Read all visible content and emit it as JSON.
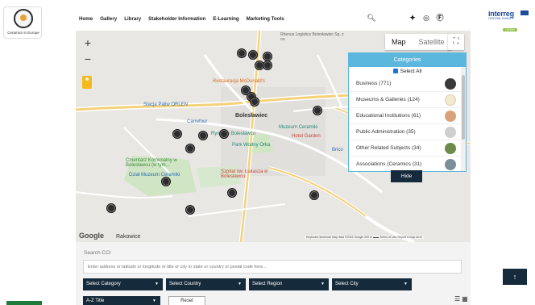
{
  "header": {
    "logo_text": "Ceramics in Europe",
    "nav": [
      "Home",
      "Gallery",
      "Library",
      "Stakeholder Information",
      "E-Learning",
      "Marketing Tools"
    ],
    "partner_logo": {
      "word": "interreg",
      "sub": "CENTRAL EUROPE",
      "badge": "CerDee"
    }
  },
  "map": {
    "zoom_in": "+",
    "zoom_out": "−",
    "type_map": "Map",
    "type_satellite": "Satellite",
    "google_label": "Google",
    "town_label": "Rakowice",
    "attribution": "Keyboard shortcuts   Map data ©2022 Google   200 m ▬▬   Terms of Use   Report a map error",
    "poi": {
      "mcdonalds": "Restauracja McDonald's",
      "orlen": "Stacja Paliw ORLEN",
      "carrefour": "Carrefour",
      "city": "Bolesławiec",
      "rynek": "Rynek w Bolesławcu",
      "museum": "Muzeum Ceramiki",
      "park": "Park Wodny Orka",
      "cemetery": "Cmentarz Komunalny w Bolesławcu (w tym...",
      "museum2": "Dział Muzeum Ceramiki",
      "hospital": "Szpital św. Łukasza w Bolesławcu",
      "hotel": "Hotel Garden",
      "logistics": "Rhenus Logistics Bolesławiec Sp. z oo",
      "brico": "Brico"
    }
  },
  "categories": {
    "title": "Categories",
    "select_all": "Select All",
    "items": [
      {
        "label": "Business (771)",
        "color": "#3a3a3a"
      },
      {
        "label": "Museums & Galleries (124)",
        "color": "#f1ead0"
      },
      {
        "label": "Educational Institutions (61)",
        "color": "#d9a27a"
      },
      {
        "label": "Public Administration (35)",
        "color": "#cfcfcf"
      },
      {
        "label": "Other Related Subjects (34)",
        "color": "#6c8a4a"
      },
      {
        "label": "Associations (Ceramics (31)",
        "color": "#7b8f9a"
      }
    ],
    "hide_label": "Hide"
  },
  "search": {
    "label": "Search CCI",
    "placeholder": "Enter address or latitude or longitude or title or city or state or country or postal code here...",
    "selects": [
      "Select Category",
      "Select Country",
      "Select Region",
      "Select City"
    ],
    "sort": "A-Z Title",
    "reset": "Reset"
  },
  "colors": {
    "accent": "#5bb7dd",
    "dark": "#152a3a"
  }
}
